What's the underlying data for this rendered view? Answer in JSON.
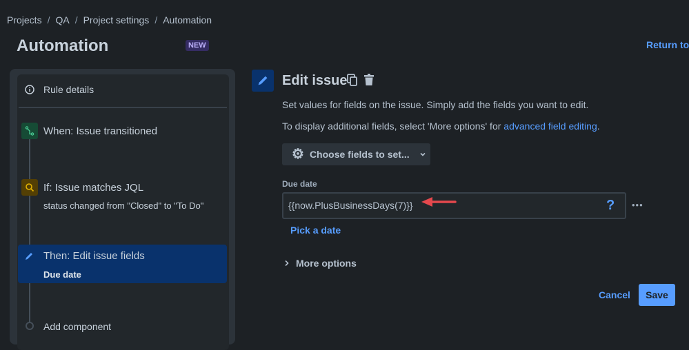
{
  "breadcrumb": [
    "Projects",
    "QA",
    "Project settings",
    "Automation"
  ],
  "page_title": "Automation",
  "new_badge": "NEW",
  "return_link": "Return to",
  "sidebar": {
    "rule_details": "Rule details",
    "trigger": {
      "label": "When: Issue transitioned",
      "color": "#1f845a"
    },
    "condition": {
      "label": "If: Issue matches JQL",
      "detail": "status changed from \"Closed\" to \"To Do\"",
      "color": "#e2b203"
    },
    "action": {
      "label": "Then: Edit issue fields",
      "detail": "Due date",
      "color": "#579dff"
    },
    "add_component": "Add component"
  },
  "editor": {
    "title": "Edit issue",
    "desc1": "Set values for fields on the issue. Simply add the fields you want to edit.",
    "desc2_prefix": "To display additional fields, select 'More options' for ",
    "desc2_link": "advanced field editing",
    "desc2_suffix": ".",
    "choose_fields": "Choose fields to set...",
    "field_label": "Due date",
    "field_value": "{{now.PlusBusinessDays(7)}}",
    "help": "?",
    "more": "•••",
    "pick_date": "Pick a date",
    "more_options": "More options",
    "cancel": "Cancel",
    "save": "Save"
  }
}
